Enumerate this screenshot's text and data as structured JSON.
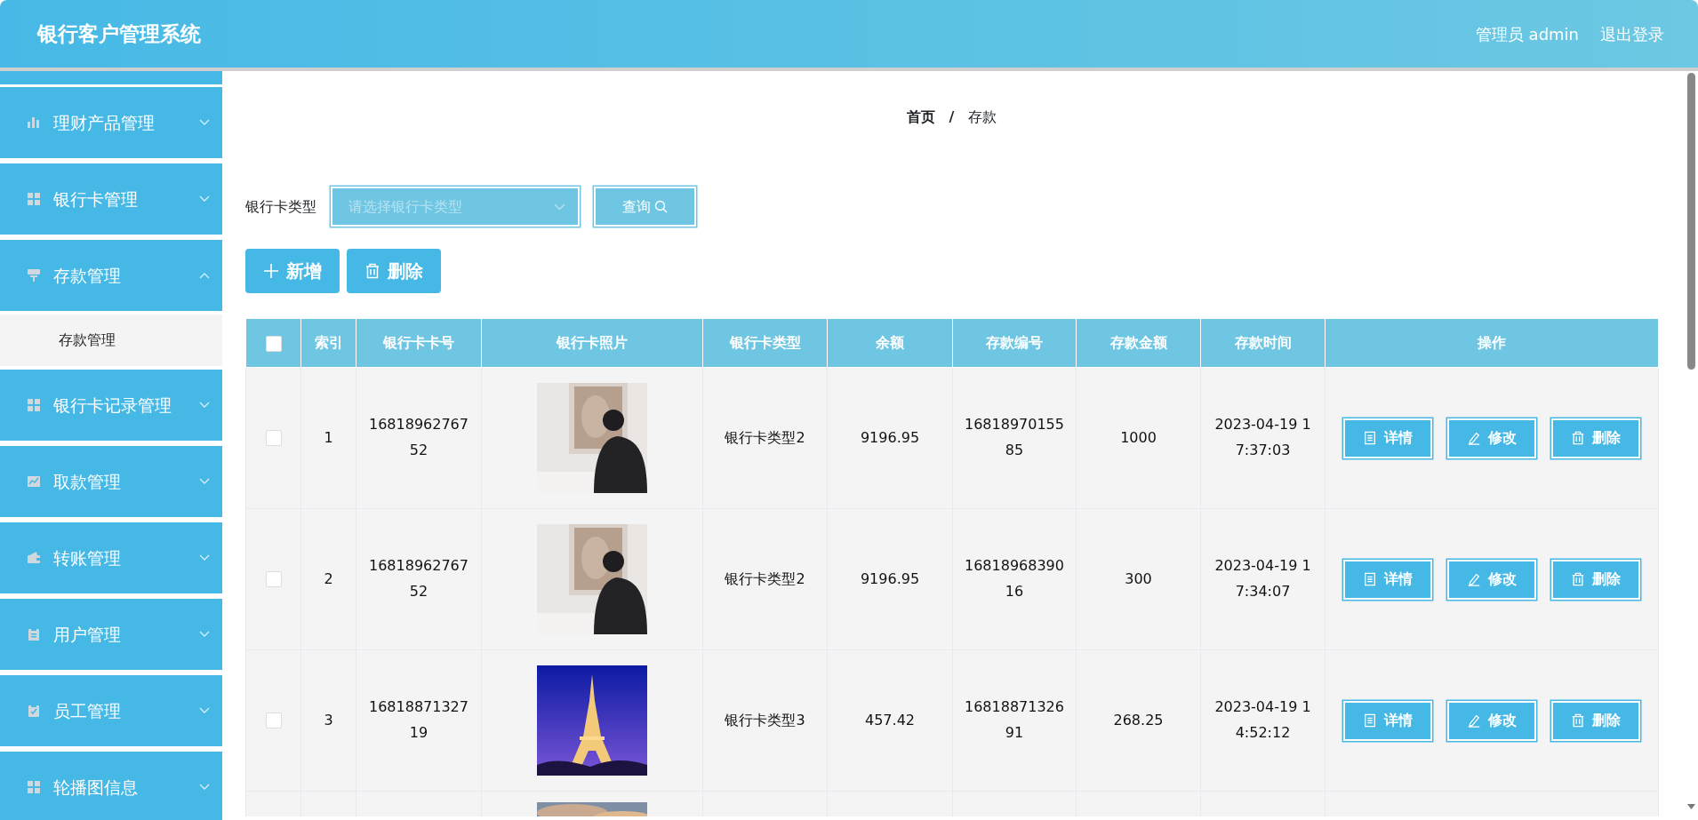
{
  "header": {
    "title": "银行客户管理系统",
    "user": "管理员 admin",
    "logout": "退出登录"
  },
  "sidebar": {
    "items": [
      {
        "label": "理财产品管理",
        "expanded": false
      },
      {
        "label": "银行卡管理",
        "expanded": false
      },
      {
        "label": "存款管理",
        "expanded": true,
        "children": [
          {
            "label": "存款管理"
          }
        ]
      },
      {
        "label": "银行卡记录管理",
        "expanded": false
      },
      {
        "label": "取款管理",
        "expanded": false
      },
      {
        "label": "转账管理",
        "expanded": false
      },
      {
        "label": "用户管理",
        "expanded": false
      },
      {
        "label": "员工管理",
        "expanded": false
      },
      {
        "label": "轮播图信息",
        "expanded": false
      }
    ]
  },
  "breadcrumb_separator": "/",
  "breadcrumb": [
    {
      "label": "首页",
      "current": false
    },
    {
      "label": "存款",
      "current": true
    }
  ],
  "filter": {
    "label": "银行卡类型",
    "placeholder": "请选择银行卡类型",
    "button": "查询"
  },
  "toolbar": [
    {
      "label": "新增",
      "kind": "add"
    },
    {
      "label": "删除",
      "kind": "delete"
    }
  ],
  "table": {
    "all_checked": false,
    "columns": [
      "索引",
      "银行卡卡号",
      "银行卡照片",
      "银行卡类型",
      "余额",
      "存款编号",
      "存款金额",
      "存款时间",
      "操作"
    ],
    "rows": [
      {
        "checked": false,
        "index": "1",
        "card_no": "1681896276752",
        "photo": {
          "kind": "picture"
        },
        "card_type": "银行卡类型2",
        "balance": "9196.95",
        "deposit_no": "1681897015585",
        "amount": "1000",
        "time": "2023-04-19 17:37:03",
        "actions": [
          {
            "label": "详情",
            "kind": "detail"
          },
          {
            "label": "修改",
            "kind": "edit"
          },
          {
            "label": "删除",
            "kind": "delete"
          }
        ]
      },
      {
        "checked": false,
        "index": "2",
        "card_no": "1681896276752",
        "photo": {
          "kind": "picture"
        },
        "card_type": "银行卡类型2",
        "balance": "9196.95",
        "deposit_no": "1681896839016",
        "amount": "300",
        "time": "2023-04-19 17:34:07",
        "actions": [
          {
            "label": "详情",
            "kind": "detail"
          },
          {
            "label": "修改",
            "kind": "edit"
          },
          {
            "label": "删除",
            "kind": "delete"
          }
        ]
      },
      {
        "checked": false,
        "index": "3",
        "card_no": "1681887132719",
        "photo": {
          "kind": "picture"
        },
        "card_type": "银行卡类型3",
        "balance": "457.42",
        "deposit_no": "1681887132691",
        "amount": "268.25",
        "time": "2023-04-19 14:52:12",
        "actions": [
          {
            "label": "详情",
            "kind": "detail"
          },
          {
            "label": "修改",
            "kind": "edit"
          },
          {
            "label": "删除",
            "kind": "delete"
          }
        ]
      },
      {
        "photo": {
          "kind": "picture"
        }
      }
    ]
  }
}
